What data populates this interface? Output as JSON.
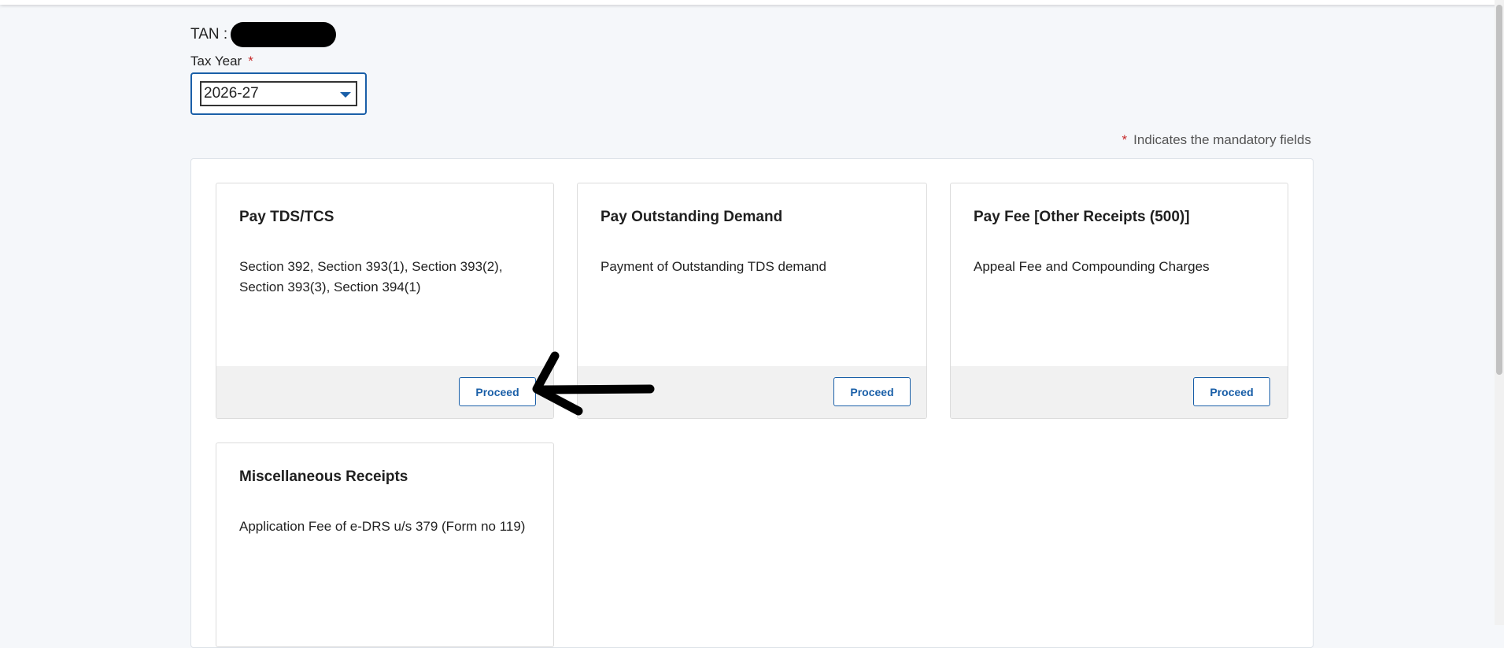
{
  "header": {
    "tan_label": "TAN :"
  },
  "form": {
    "tax_year_label": "Tax Year",
    "required_star": "*",
    "tax_year_value": "2026-27"
  },
  "mandatory_note": {
    "star": "*",
    "text": "Indicates the mandatory fields"
  },
  "cards": [
    {
      "title": "Pay TDS/TCS",
      "description": "Section 392, Section 393(1), Section 393(2), Section 393(3), Section 394(1)",
      "button": "Proceed"
    },
    {
      "title": "Pay Outstanding Demand",
      "description": "Payment of Outstanding TDS demand",
      "button": "Proceed"
    },
    {
      "title": "Pay Fee [Other Receipts (500)]",
      "description": "Appeal Fee and Compounding Charges",
      "button": "Proceed"
    },
    {
      "title": "Miscellaneous Receipts",
      "description": "Application Fee of e-DRS u/s 379 (Form no 119)"
    }
  ],
  "colors": {
    "accent": "#1a5fa8",
    "required": "#c62828",
    "page_bg": "#f5f7fa",
    "card_footer_bg": "#f1f1f1"
  },
  "icons": {
    "dropdown": "chevron-down-icon",
    "annotation": "arrow-annotation-icon"
  }
}
